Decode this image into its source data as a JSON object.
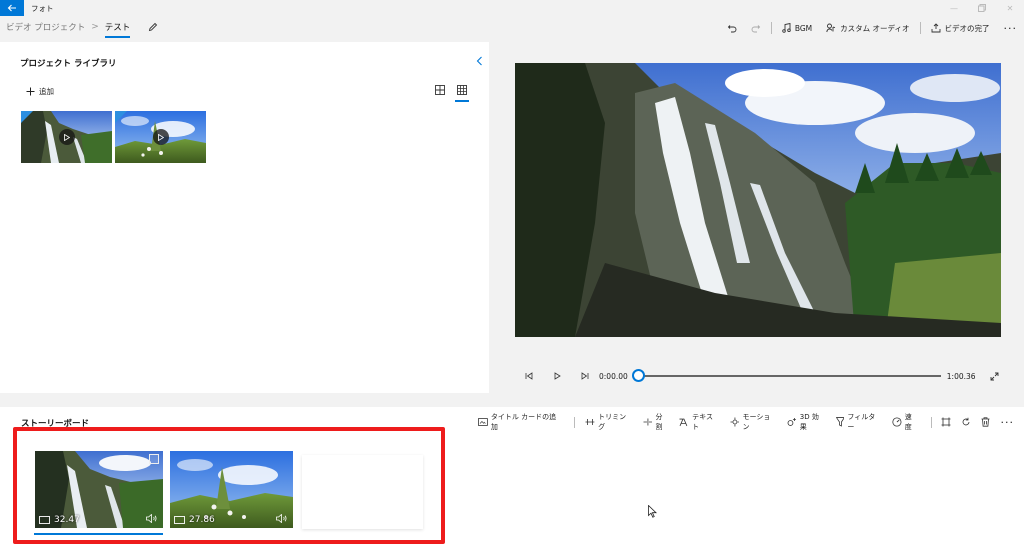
{
  "app": {
    "title": "フォト"
  },
  "breadcrumb": {
    "root": "ビデオ プロジェクト",
    "separator": ">",
    "current": "テスト"
  },
  "top_toolbar": {
    "bgm": "BGM",
    "custom_audio": "カスタム オーディオ",
    "finish_video": "ビデオの完了"
  },
  "library": {
    "title": "プロジェクト ライブラリ",
    "add_label": "追加"
  },
  "player": {
    "current_time": "0:00.00",
    "total_time": "1:00.36",
    "progress": 0
  },
  "storyboard": {
    "title": "ストーリーボード",
    "tools": {
      "title_card": "タイトル カードの追加",
      "trim": "トリミング",
      "split": "分割",
      "text": "テキスト",
      "motion": "モーション",
      "effects_3d": "3D 効果",
      "filters": "フィルター",
      "speed": "速度"
    },
    "clips": [
      {
        "duration": "32.47"
      },
      {
        "duration": "27.86"
      }
    ]
  },
  "colors": {
    "accent": "#0078d7",
    "highlight": "#ee1c1c"
  }
}
